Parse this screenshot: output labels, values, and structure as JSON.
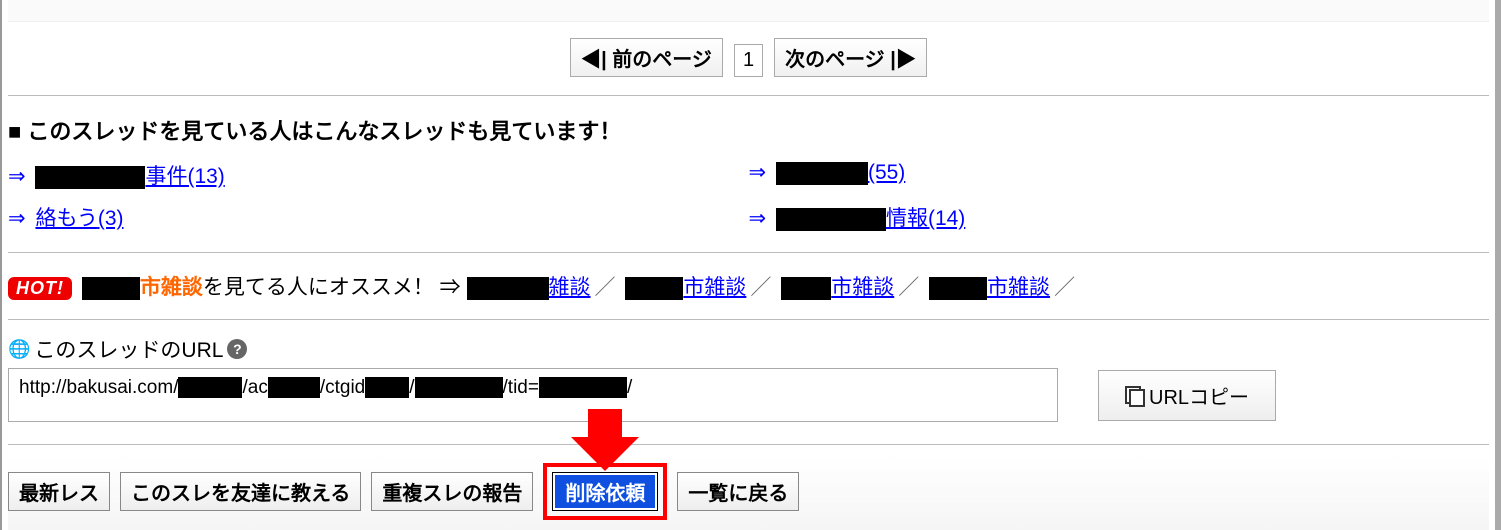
{
  "pager": {
    "prev": "◀| 前のページ",
    "page": "1",
    "next": "次のページ |▶"
  },
  "related": {
    "heading": "■ このスレッドを見ている人はこんなスレッドも見ています！",
    "items": [
      {
        "suffix": "事件",
        "count": "(13)"
      },
      {
        "suffix": "",
        "count": "(55)"
      },
      {
        "prefix": "絡もう",
        "count": "(3)"
      },
      {
        "suffix": "情報",
        "count": "(14)"
      }
    ]
  },
  "hot": {
    "badge": "HOT!",
    "topic_suffix": "市雑談",
    "tagline": "を見てる人にオススメ！ ⇒",
    "links": [
      {
        "suffix": "雑談"
      },
      {
        "suffix": "市雑談"
      },
      {
        "suffix": "市雑談"
      },
      {
        "suffix": "市雑談"
      }
    ]
  },
  "url": {
    "label": "このスレッドのURL",
    "prefix": "http://bakusai.com/",
    "part1": "/ac",
    "part2": "/ctgid",
    "part3": "/",
    "part4": "/tid=",
    "part5": "/",
    "copy": "URLコピー"
  },
  "buttons": {
    "latest": "最新レス",
    "tell": "このスレを友達に教える",
    "dup": "重複スレの報告",
    "delete": "削除依頼",
    "back": "一覧に戻る"
  }
}
